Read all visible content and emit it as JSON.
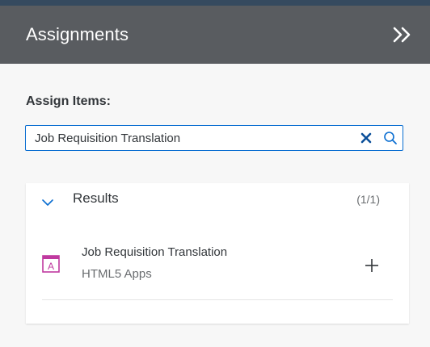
{
  "header": {
    "title": "Assignments",
    "collapse_icon": "double-chevron-right-icon"
  },
  "assign": {
    "label": "Assign Items:"
  },
  "search": {
    "value": "Job Requisition Translation",
    "clear_icon": "close-icon",
    "search_icon": "search-icon"
  },
  "results": {
    "title": "Results",
    "count": "(1/1)",
    "expanded": true,
    "items": [
      {
        "title": "Job Requisition Translation",
        "subtitle": "HTML5 Apps",
        "icon": "html5-app-icon",
        "action_icon": "plus-icon"
      }
    ]
  },
  "colors": {
    "header_bg": "#595c60",
    "topline": "#354a5f",
    "accent": "#0a6ed1",
    "app_icon": "#c0399f",
    "page_bg": "#f7f7f7"
  }
}
